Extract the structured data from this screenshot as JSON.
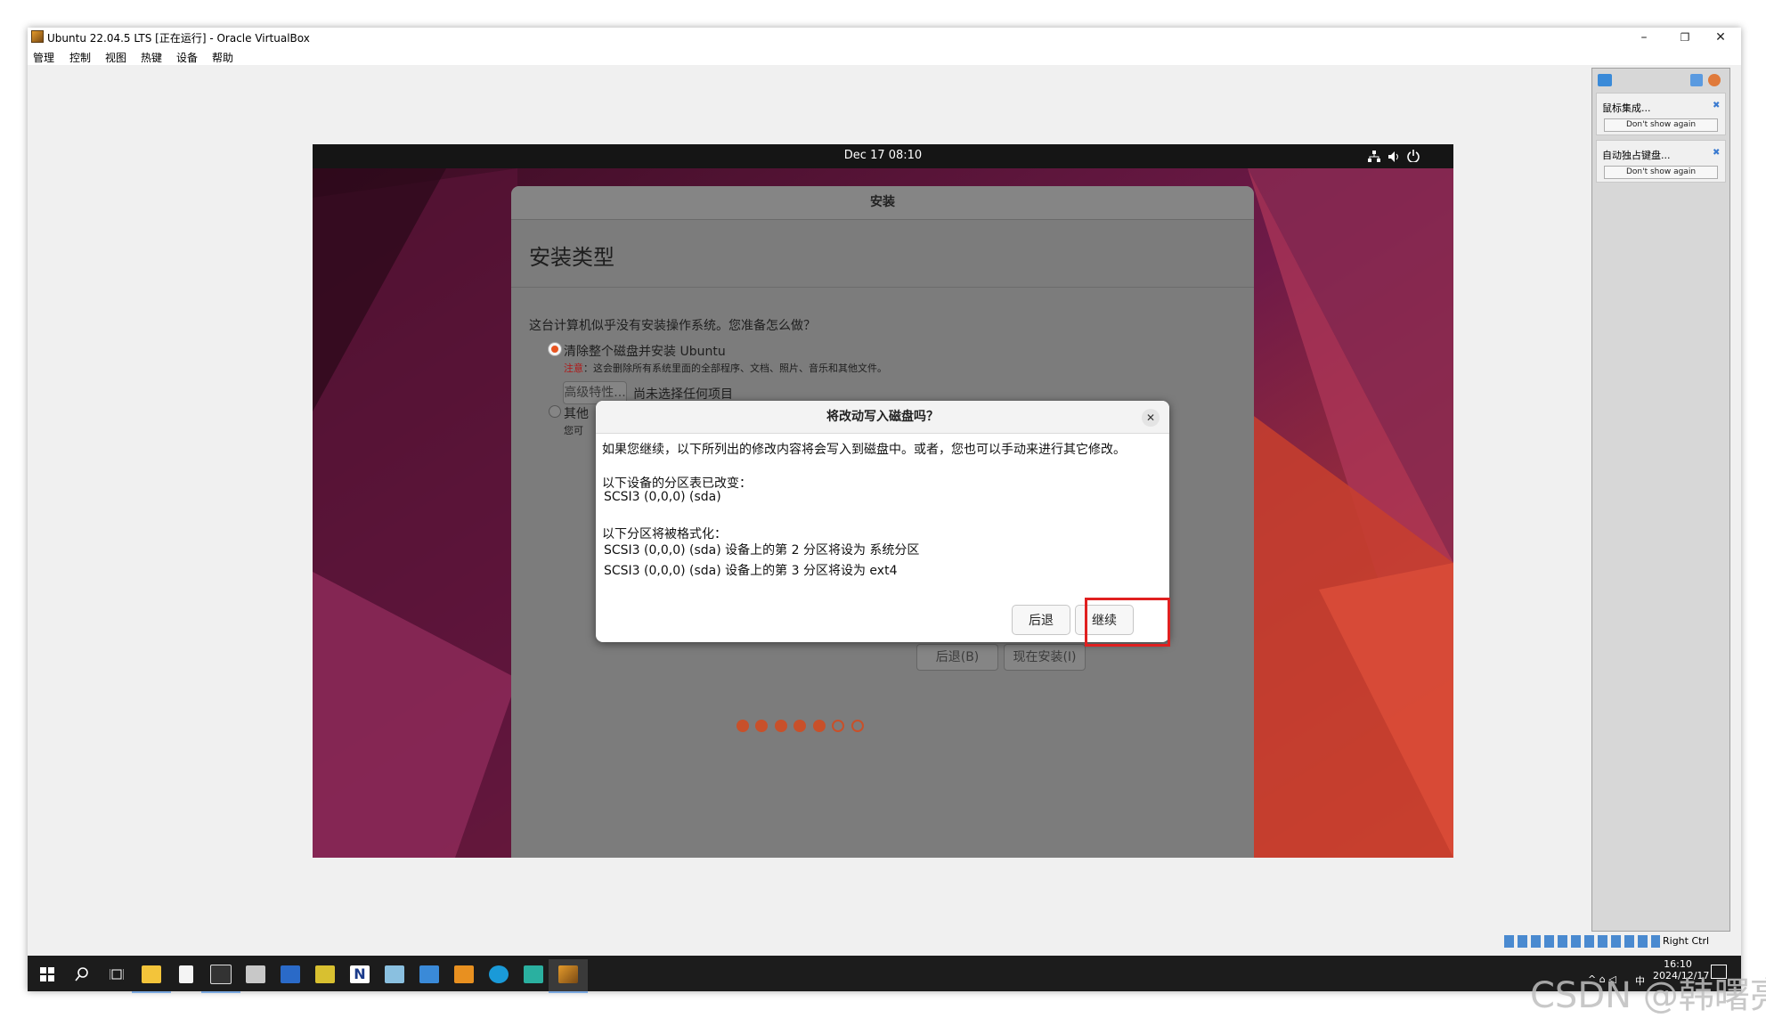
{
  "window": {
    "title": "Ubuntu 22.04.5 LTS [正在运行] - Oracle VirtualBox",
    "minimize": "–",
    "maximize": "❐",
    "close": "✕"
  },
  "menubar": [
    "管理",
    "控制",
    "视图",
    "热键",
    "设备",
    "帮助"
  ],
  "guest": {
    "topbar": {
      "clock": "Dec 17  08:10"
    },
    "installer": {
      "header": "安装",
      "title": "安装类型",
      "question": "这台计算机似乎没有安装操作系统。您准备怎么做？",
      "option_erase": "清除整个磁盘并安装 Ubuntu",
      "warning_label": "注意",
      "warning_text": "：这会删除所有系统里面的全部程序、文档、照片、音乐和其他文件。",
      "advanced_button": "高级特性...",
      "advanced_status": "尚未选择任何项目",
      "option_other": "其他",
      "option_other_sub": "您可",
      "back_button": "后退(B)",
      "install_button": "现在安装(I)",
      "progress": {
        "completed_steps": 5,
        "total_steps": 7
      }
    },
    "dialog": {
      "title": "将改动写入磁盘吗？",
      "close": "✕",
      "line1": "如果您继续，以下所列出的修改内容将会写入到磁盘中。或者，您也可以手动来进行其它修改。",
      "line2": "以下设备的分区表已改变：",
      "line3": "SCSI3 (0,0,0) (sda)",
      "line4": "以下分区将被格式化：",
      "line5": "SCSI3 (0,0,0) (sda) 设备上的第 2 分区将设为 系统分区",
      "line6": "SCSI3 (0,0,0) (sda) 设备上的第 3 分区将设为 ext4",
      "back_button": "后退",
      "continue_button": "继续"
    }
  },
  "side_panel": {
    "notifications": [
      {
        "title": "鼠标集成...",
        "button": "Don't show again"
      },
      {
        "title": "自动独占键盘...",
        "button": "Don't show again"
      }
    ]
  },
  "statusbar": {
    "host_key": "Right Ctrl"
  },
  "taskbar": {
    "time": "16:10",
    "date": "2024/12/17",
    "ime": "中"
  },
  "watermark": "CSDN @韩曙亮",
  "colors": {
    "ubuntu_orange": "#e95420",
    "highlight_red": "#e02020"
  }
}
